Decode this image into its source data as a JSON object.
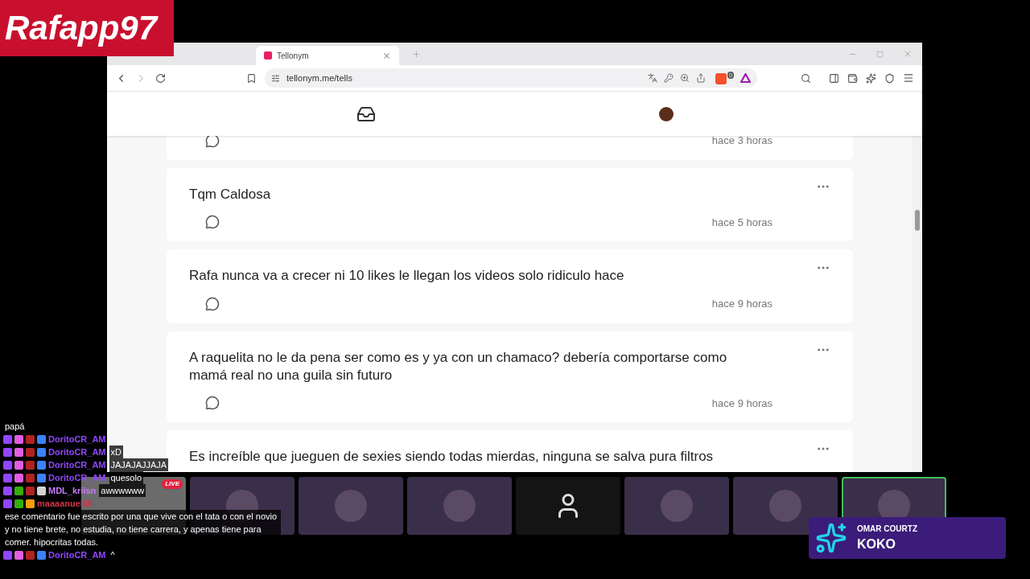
{
  "logo": {
    "text": "Rafapp97"
  },
  "browser": {
    "tab": {
      "title": "Tellonym",
      "selected": true
    },
    "address": "tellonym.me/tells",
    "shield_count": "0"
  },
  "tells": [
    {
      "time": "hace 3 horas"
    },
    {
      "text": "Tqm Caldosa",
      "time": "hace 5 horas"
    },
    {
      "text": "Rafa nunca va a crecer ni 10 likes le llegan los videos solo ridiculo hace",
      "time": "hace 9 horas"
    },
    {
      "text": "A raquelita no le da pena ser como es y ya con un chamaco? debería comportarse como mamá real no una guila sin futuro",
      "time": "hace 9 horas"
    },
    {
      "text": "Es increíble que jueguen de sexies siendo todas mierdas, ninguna se salva pura filtros"
    }
  ],
  "chat": [
    {
      "text": "papá"
    },
    {
      "user": "DoritoCR_AM",
      "color": "#9146ff",
      "badges": [
        {
          "kind": "twitch"
        },
        {
          "kind": "sub"
        },
        {
          "kind": "bits"
        },
        {
          "kind": "gift"
        }
      ]
    },
    {
      "user": "DoritoCR_AM",
      "color": "#9146ff",
      "text": "xD",
      "badges": [
        {
          "kind": "twitch"
        },
        {
          "kind": "sub"
        },
        {
          "kind": "bits"
        },
        {
          "kind": "gift"
        }
      ]
    },
    {
      "user": "DoritoCR_AM",
      "color": "#9146ff",
      "text": "JAJAJAJJAJA",
      "badges": [
        {
          "kind": "twitch"
        },
        {
          "kind": "sub"
        },
        {
          "kind": "bits"
        },
        {
          "kind": "gift"
        }
      ]
    },
    {
      "user": "DoritoCR_AM",
      "color": "#9146ff",
      "text": "quesolo",
      "badges": [
        {
          "kind": "twitch"
        },
        {
          "kind": "sub"
        },
        {
          "kind": "bits"
        },
        {
          "kind": "gift"
        }
      ]
    },
    {
      "user": "MDL_kriisn",
      "color": "#c77dff",
      "text": "awwwwww",
      "badges": [
        {
          "kind": "twitch"
        },
        {
          "kind": "mod"
        },
        {
          "kind": "bits"
        },
        {
          "kind": "vip"
        }
      ]
    },
    {
      "user": "maaaanuelllll",
      "color": "#d2334a",
      "text": "ese comentario fue escrito por una que vive con el tata o con el novio y no tiene brete, no estudia, no tiene carrera, y apenas tiene para comer. hipocritas todas.",
      "badges": [
        {
          "kind": "twitch"
        },
        {
          "kind": "mod"
        },
        {
          "kind": "star"
        }
      ]
    },
    {
      "user": "DoritoCR_AM",
      "color": "#9146ff",
      "text": "^",
      "badges": [
        {
          "kind": "twitch"
        },
        {
          "kind": "sub"
        },
        {
          "kind": "bits"
        },
        {
          "kind": "gift"
        }
      ]
    }
  ],
  "video_tiles": [
    {
      "kind": "screen",
      "badge": "LIVE",
      "speaking": false
    },
    {
      "kind": "camera",
      "speaking": false
    },
    {
      "kind": "camera",
      "speaking": false
    },
    {
      "kind": "camera",
      "speaking": false
    },
    {
      "kind": "avatar",
      "speaking": false
    },
    {
      "kind": "camera",
      "speaking": false
    },
    {
      "kind": "camera",
      "speaking": false
    },
    {
      "kind": "camera",
      "speaking": true
    }
  ],
  "name_card": {
    "subtitle": "OMAR COURTZ",
    "name": "KOKO"
  }
}
